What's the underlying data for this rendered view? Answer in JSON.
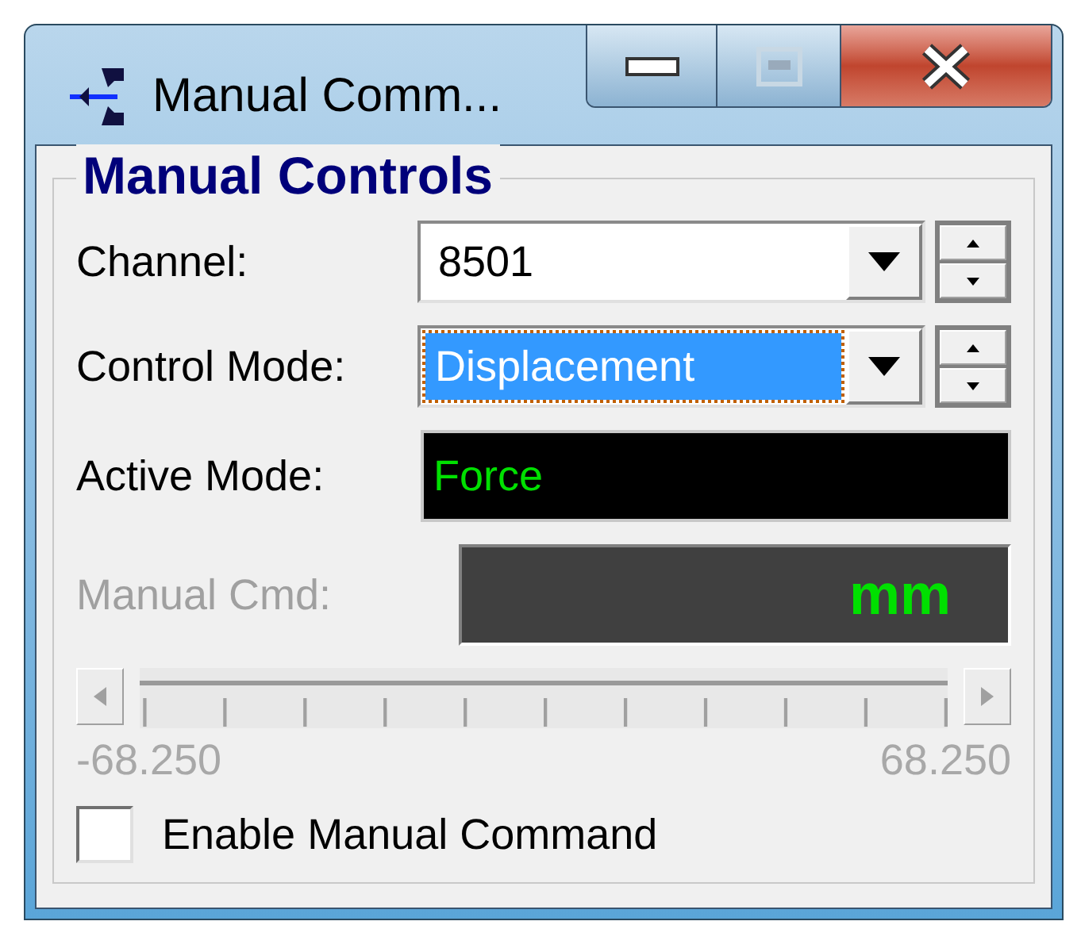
{
  "window": {
    "title": "Manual Comm..."
  },
  "group": {
    "title": "Manual Controls"
  },
  "channel": {
    "label": "Channel:",
    "value": "8501",
    "focused": false
  },
  "control_mode": {
    "label": "Control Mode:",
    "value": "Displacement",
    "focused": true
  },
  "active_mode": {
    "label": "Active Mode:",
    "value": "Force"
  },
  "manual_cmd": {
    "label": "Manual Cmd:",
    "unit": "mm",
    "disabled": true
  },
  "slider": {
    "min_label": "-68.250",
    "max_label": "68.250",
    "disabled": true
  },
  "enable_checkbox": {
    "label": "Enable Manual Command",
    "checked": false
  }
}
